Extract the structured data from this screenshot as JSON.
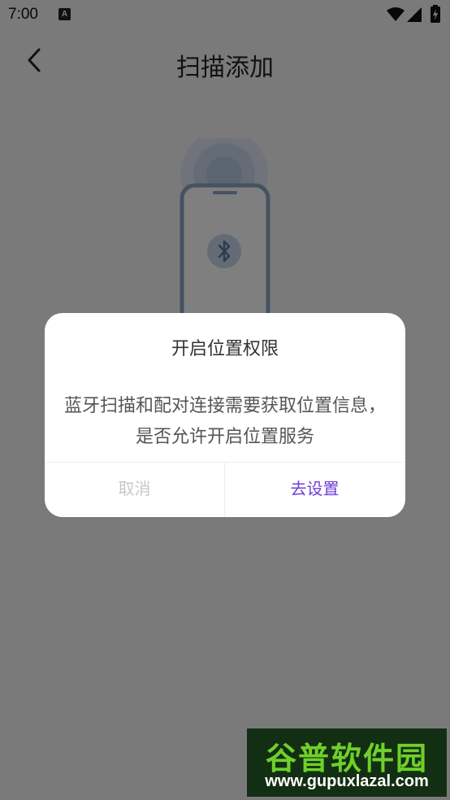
{
  "status_bar": {
    "time": "7:00",
    "notification_icon": "a-icon",
    "icons": [
      "wifi-icon",
      "signal-icon",
      "battery-icon"
    ]
  },
  "header": {
    "title": "扫描添加",
    "back_icon": "chevron-left-icon"
  },
  "illustration": {
    "icon": "bluetooth-icon"
  },
  "dialog": {
    "title": "开启位置权限",
    "message": "蓝牙扫描和配对连接需要获取位置信息，是否允许开启位置服务",
    "cancel_label": "取消",
    "confirm_label": "去设置"
  },
  "watermark": {
    "logo": "谷普软件园",
    "url": "www.gupuxlazal.com"
  },
  "colors": {
    "accent": "#6f3fd6",
    "overlay": "rgba(0,0,0,0.5)",
    "dialog_bg": "#ffffff",
    "page_bg": "#f5f5f7"
  }
}
